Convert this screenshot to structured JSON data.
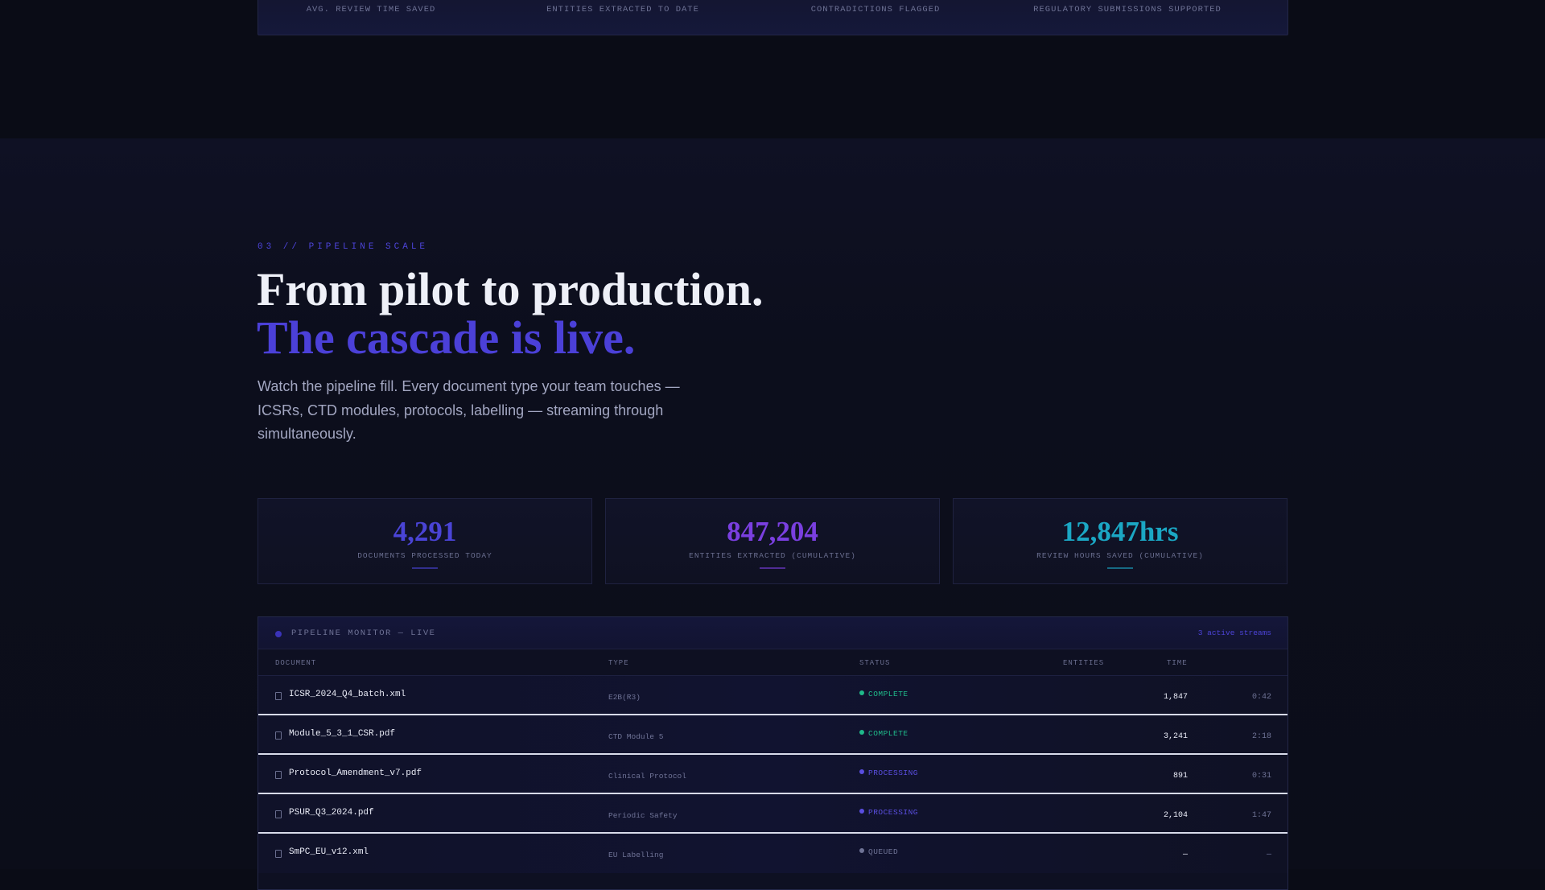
{
  "top_strip": {
    "labels": [
      "AVG. REVIEW TIME SAVED",
      "ENTITIES EXTRACTED TO DATE",
      "CONTRADICTIONS FLAGGED",
      "REGULATORY SUBMISSIONS SUPPORTED"
    ]
  },
  "section": {
    "eyebrow": "03 // PIPELINE SCALE",
    "headline_line1": "From pilot to production.",
    "headline_line2": "The cascade is live.",
    "subtitle": "Watch the pipeline fill. Every document type your team touches — ICSRs, CTD modules, protocols, labelling — streaming through simultaneously."
  },
  "stats": [
    {
      "value": "4,291",
      "caption": "DOCUMENTS PROCESSED TODAY",
      "color": "#4a44d6"
    },
    {
      "value": "847,204",
      "caption": "ENTITIES EXTRACTED (CUMULATIVE)",
      "color": "#7a3fe0"
    },
    {
      "value": "12,847hrs",
      "caption": "REVIEW HOURS SAVED (CUMULATIVE)",
      "color": "#1ba7c4"
    }
  ],
  "monitor": {
    "title": "PIPELINE MONITOR — LIVE",
    "streams": "3 active streams",
    "columns": {
      "document": "DOCUMENT",
      "type": "TYPE",
      "status": "STATUS",
      "entities": "ENTITIES",
      "time": "TIME"
    },
    "rows": [
      {
        "document": "ICSR_2024_Q4_batch.xml",
        "type": "E2B(R3)",
        "status": "COMPLETE",
        "status_color": "#1fb98a",
        "entities": "1,847",
        "time": "0:42"
      },
      {
        "document": "Module_5_3_1_CSR.pdf",
        "type": "CTD Module 5",
        "status": "COMPLETE",
        "status_color": "#1fb98a",
        "entities": "3,241",
        "time": "2:18"
      },
      {
        "document": "Protocol_Amendment_v7.pdf",
        "type": "Clinical Protocol",
        "status": "PROCESSING",
        "status_color": "#5a4ee0",
        "entities": "891",
        "time": "0:31"
      },
      {
        "document": "PSUR_Q3_2024.pdf",
        "type": "Periodic Safety",
        "status": "PROCESSING",
        "status_color": "#5a4ee0",
        "entities": "2,104",
        "time": "1:47"
      },
      {
        "document": "SmPC_EU_v12.xml",
        "type": "EU Labelling",
        "status": "QUEUED",
        "status_color": "#6f7396",
        "entities": "—",
        "time": "—"
      }
    ]
  }
}
